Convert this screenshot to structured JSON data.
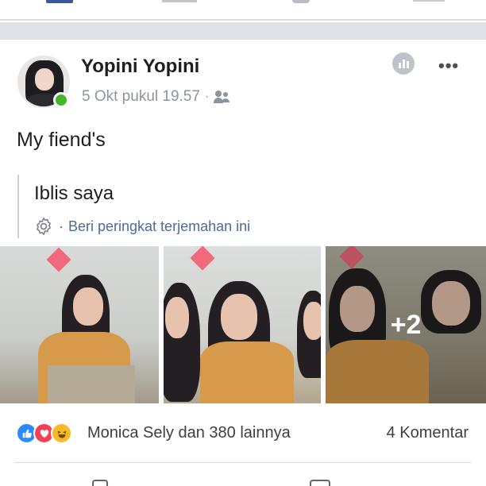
{
  "post": {
    "author": "Yopini Yopini",
    "timestamp": "5 Okt pukul 19.57",
    "separator": "·",
    "audience_icon": "friends-audience-icon",
    "text": "My fiend's",
    "translation": {
      "text": "Iblis saya",
      "separator": "·",
      "rate_label": "Beri peringkat terjemahan ini"
    },
    "photos": {
      "more_count": "+2"
    },
    "reactions": {
      "types": [
        "like",
        "love",
        "haha"
      ],
      "summary": "Monica Sely dan 380 lainnya"
    },
    "comments_label": "4 Komentar"
  },
  "colors": {
    "brand": "#3b5998",
    "online": "#42b72a",
    "link": "#4b6b9a",
    "like": "#2d88ff",
    "love": "#f33e58",
    "haha": "#f7b928"
  }
}
